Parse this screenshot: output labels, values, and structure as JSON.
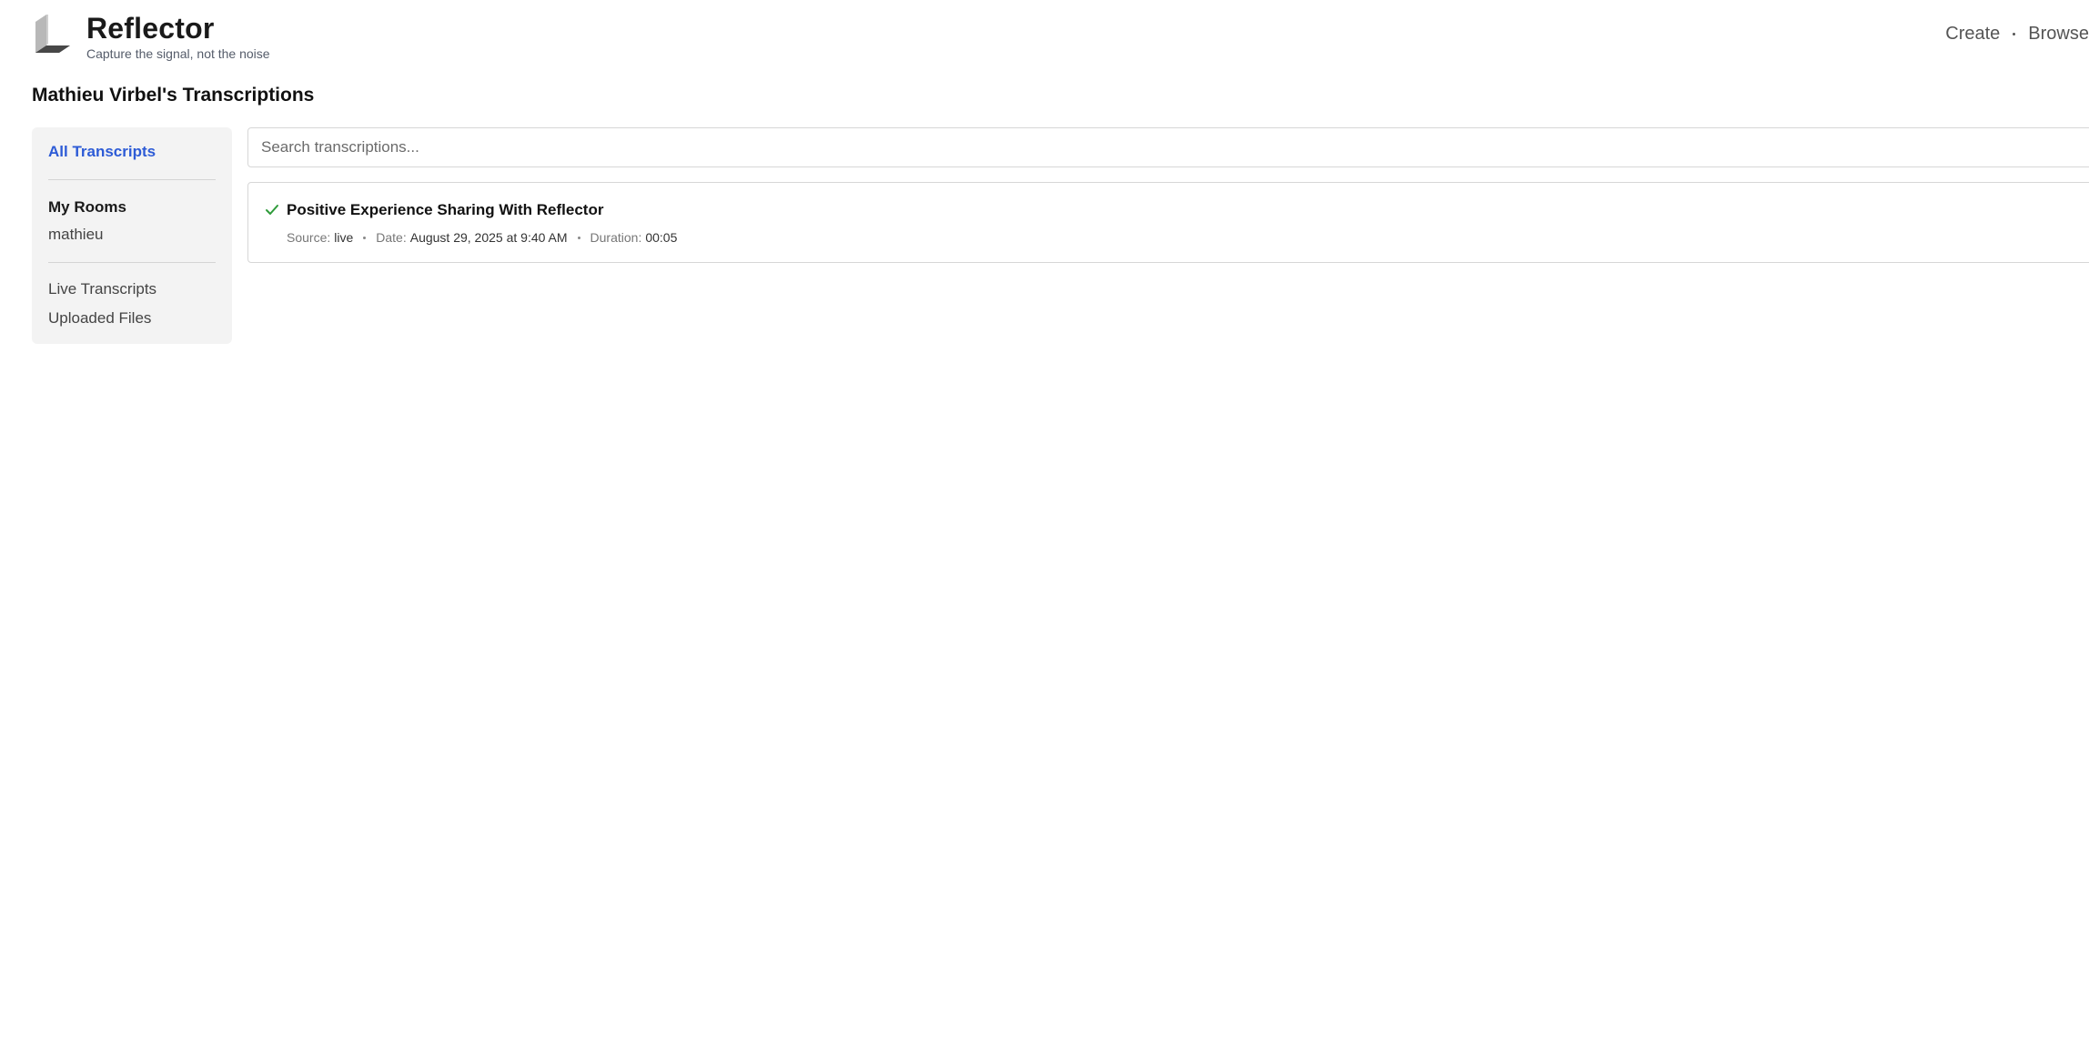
{
  "header": {
    "brand_title": "Reflector",
    "brand_tagline": "Capture the signal, not the noise",
    "nav": {
      "create_label": "Create",
      "browse_label": "Browse"
    }
  },
  "page_title": "Mathieu Virbel's Transcriptions",
  "sidebar": {
    "all_transcripts": "All Transcripts",
    "my_rooms_heading": "My Rooms",
    "rooms": [
      "mathieu"
    ],
    "live_transcripts": "Live Transcripts",
    "uploaded_files": "Uploaded Files"
  },
  "search": {
    "placeholder": "Search transcriptions...",
    "value": ""
  },
  "transcripts": [
    {
      "status_icon": "check-icon",
      "title": "Positive Experience Sharing With Reflector",
      "source_label": "Source:",
      "source": "live",
      "date_label": "Date:",
      "date": "August 29, 2025 at 9:40 AM",
      "duration_label": "Duration:",
      "duration": "00:05"
    }
  ],
  "colors": {
    "accent": "#2d5bd6",
    "success": "#2e9b3a",
    "sidebar_bg": "#f3f3f3",
    "border": "#d7d7d7"
  }
}
